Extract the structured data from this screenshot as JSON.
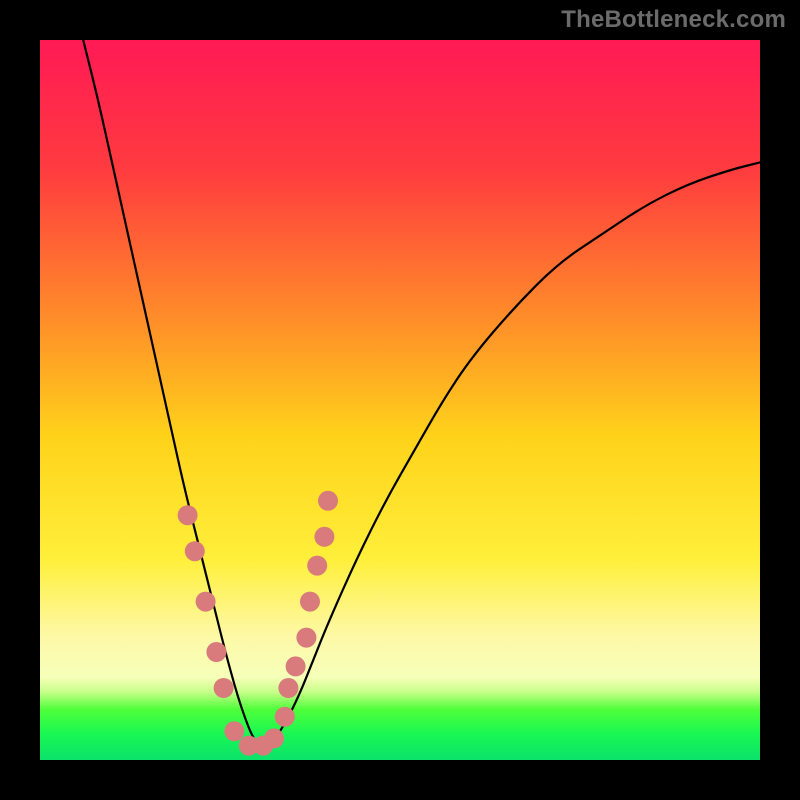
{
  "watermark": "TheBottleneck.com",
  "chart_data": {
    "type": "line",
    "title": "",
    "xlabel": "",
    "ylabel": "",
    "xlim": [
      0,
      100
    ],
    "ylim": [
      0,
      100
    ],
    "gradient_stops": [
      {
        "offset": 0.0,
        "color": "#ff1a55"
      },
      {
        "offset": 0.18,
        "color": "#ff3b3f"
      },
      {
        "offset": 0.38,
        "color": "#ff8a2a"
      },
      {
        "offset": 0.55,
        "color": "#ffd21a"
      },
      {
        "offset": 0.72,
        "color": "#ffef3a"
      },
      {
        "offset": 0.83,
        "color": "#fdf9a8"
      },
      {
        "offset": 0.885,
        "color": "#f6ffb8"
      },
      {
        "offset": 0.905,
        "color": "#c9ff8a"
      },
      {
        "offset": 0.93,
        "color": "#4eff3a"
      },
      {
        "offset": 0.965,
        "color": "#18f754"
      },
      {
        "offset": 1.0,
        "color": "#0ae26b"
      }
    ],
    "curve": {
      "comment": "V-shaped bottleneck curve; y is percent (0 at bottom/green, 100 at top/red). Minimum near x≈30.",
      "x": [
        6,
        8,
        10,
        12,
        14,
        16,
        18,
        20,
        22,
        24,
        26,
        28,
        30,
        32,
        34,
        36,
        38,
        40,
        44,
        48,
        52,
        56,
        60,
        66,
        72,
        78,
        84,
        90,
        96,
        100
      ],
      "y": [
        100,
        92,
        83,
        74,
        65,
        56,
        47,
        38,
        30,
        22,
        14,
        7,
        2,
        2,
        5,
        9,
        14,
        19,
        28,
        36,
        43,
        50,
        56,
        63,
        69,
        73,
        77,
        80,
        82,
        83
      ]
    },
    "markers": {
      "comment": "Pink rounded markers clustered along the lower V near the minimum.",
      "color": "#d97a7d",
      "radius_px": 10,
      "points": [
        {
          "x": 20.5,
          "y": 34
        },
        {
          "x": 21.5,
          "y": 29
        },
        {
          "x": 23.0,
          "y": 22
        },
        {
          "x": 24.5,
          "y": 15
        },
        {
          "x": 25.5,
          "y": 10
        },
        {
          "x": 27.0,
          "y": 4
        },
        {
          "x": 29.0,
          "y": 2
        },
        {
          "x": 31.0,
          "y": 2
        },
        {
          "x": 32.5,
          "y": 3
        },
        {
          "x": 34.0,
          "y": 6
        },
        {
          "x": 34.5,
          "y": 10
        },
        {
          "x": 35.5,
          "y": 13
        },
        {
          "x": 37.0,
          "y": 17
        },
        {
          "x": 37.5,
          "y": 22
        },
        {
          "x": 38.5,
          "y": 27
        },
        {
          "x": 39.5,
          "y": 31
        },
        {
          "x": 40.0,
          "y": 36
        }
      ]
    }
  }
}
